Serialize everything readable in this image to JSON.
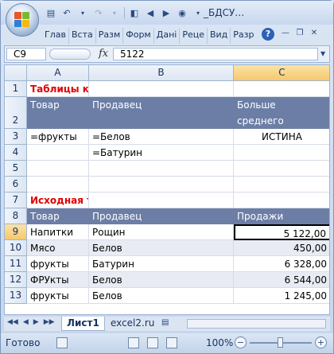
{
  "window": {
    "title": "_БДСУ…"
  },
  "ribbon_tabs": [
    "Глав",
    "Вста",
    "Разм",
    "Форм",
    "Дані",
    "Реце",
    "Вид",
    "Разр"
  ],
  "formula_bar": {
    "name_box": "C9",
    "fx_label": "fx",
    "value": "5122"
  },
  "columns": [
    "A",
    "B",
    "C"
  ],
  "rows": [
    {
      "num": "1",
      "cells": [
        "Таблицы критериев",
        "",
        ""
      ]
    },
    {
      "num": "2",
      "cells": [
        "Товар",
        "Продавец",
        "Больше среднего"
      ]
    },
    {
      "num": "3",
      "cells": [
        "=фрукты",
        "=Белов",
        "ИСТИНА"
      ]
    },
    {
      "num": "4",
      "cells": [
        "",
        "=Батурин",
        ""
      ]
    },
    {
      "num": "5",
      "cells": [
        "",
        "",
        ""
      ]
    },
    {
      "num": "6",
      "cells": [
        "",
        "",
        ""
      ]
    },
    {
      "num": "7",
      "cells": [
        "Исходная таблица",
        "",
        ""
      ]
    },
    {
      "num": "8",
      "cells": [
        "Товар",
        "Продавец",
        "Продажи"
      ]
    },
    {
      "num": "9",
      "cells": [
        "Напитки",
        "Рощин",
        "5 122,00"
      ]
    },
    {
      "num": "10",
      "cells": [
        "Мясо",
        "Белов",
        "450,00"
      ]
    },
    {
      "num": "11",
      "cells": [
        "фрукты",
        "Батурин",
        "6 328,00"
      ]
    },
    {
      "num": "12",
      "cells": [
        "ФРУкты",
        "Белов",
        "6 544,00"
      ]
    },
    {
      "num": "13",
      "cells": [
        "фрукты",
        "Белов",
        "1 245,00"
      ]
    }
  ],
  "row2_c_line1": "Больше",
  "row2_c_line2": "среднего",
  "sheets": [
    "Лист1",
    "excel2.ru"
  ],
  "active_sheet": "Лист1",
  "status": {
    "ready": "Готово",
    "zoom": "100%",
    "zoom_minus": "−",
    "zoom_plus": "+"
  },
  "colors": {
    "header_fill": "#6c7ea6",
    "title_red": "#e00000",
    "stripe": "#e8ebf3"
  }
}
